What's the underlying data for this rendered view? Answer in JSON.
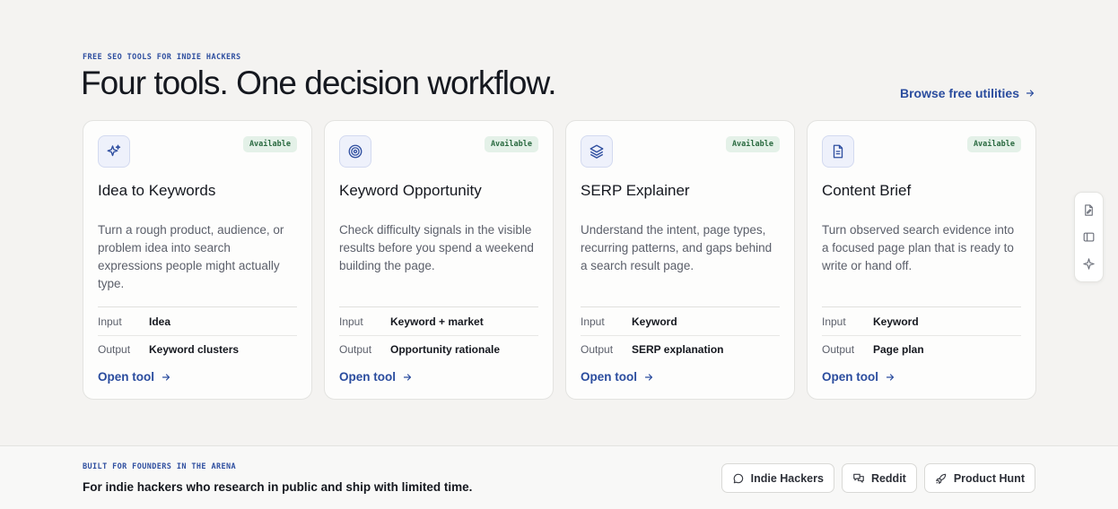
{
  "hero": {
    "eyebrow": "FREE SEO TOOLS FOR INDIE HACKERS",
    "title": "Four tools. One decision workflow.",
    "browse_label": "Browse free utilities"
  },
  "tools": [
    {
      "icon": "sparkles-icon",
      "badge": "Available",
      "title": "Idea to Keywords",
      "description": "Turn a rough product, audience, or problem idea into search expressions people might actually type.",
      "input_label": "Input",
      "input_value": "Idea",
      "output_label": "Output",
      "output_value": "Keyword clusters",
      "open_label": "Open tool"
    },
    {
      "icon": "target-icon",
      "badge": "Available",
      "title": "Keyword Opportunity",
      "description": "Check difficulty signals in the visible results before you spend a weekend building the page.",
      "input_label": "Input",
      "input_value": "Keyword + market",
      "output_label": "Output",
      "output_value": "Opportunity rationale",
      "open_label": "Open tool"
    },
    {
      "icon": "layers-icon",
      "badge": "Available",
      "title": "SERP Explainer",
      "description": "Understand the intent, page types, recurring patterns, and gaps behind a search result page.",
      "input_label": "Input",
      "input_value": "Keyword",
      "output_label": "Output",
      "output_value": "SERP explanation",
      "open_label": "Open tool"
    },
    {
      "icon": "document-icon",
      "badge": "Available",
      "title": "Content Brief",
      "description": "Turn observed search evidence into a focused page plan that is ready to write or hand off.",
      "input_label": "Input",
      "input_value": "Keyword",
      "output_label": "Output",
      "output_value": "Page plan",
      "open_label": "Open tool"
    }
  ],
  "footer": {
    "eyebrow": "BUILT FOR FOUNDERS IN THE ARENA",
    "text": "For indie hackers who research in public and ship with limited time.",
    "links": [
      {
        "label": "Indie Hackers",
        "icon": "chat-bubble-icon"
      },
      {
        "label": "Reddit",
        "icon": "chat-bubbles-icon"
      },
      {
        "label": "Product Hunt",
        "icon": "rocket-icon"
      }
    ]
  },
  "floating_toolbar": {
    "icons": [
      "edit-document-icon",
      "sidebar-icon",
      "sparkle-icon"
    ]
  },
  "colors": {
    "accent": "#2a4c9e",
    "badge_bg": "#e4f1e8",
    "badge_text": "#2a6a40",
    "page_bg": "#f4f3f1"
  }
}
